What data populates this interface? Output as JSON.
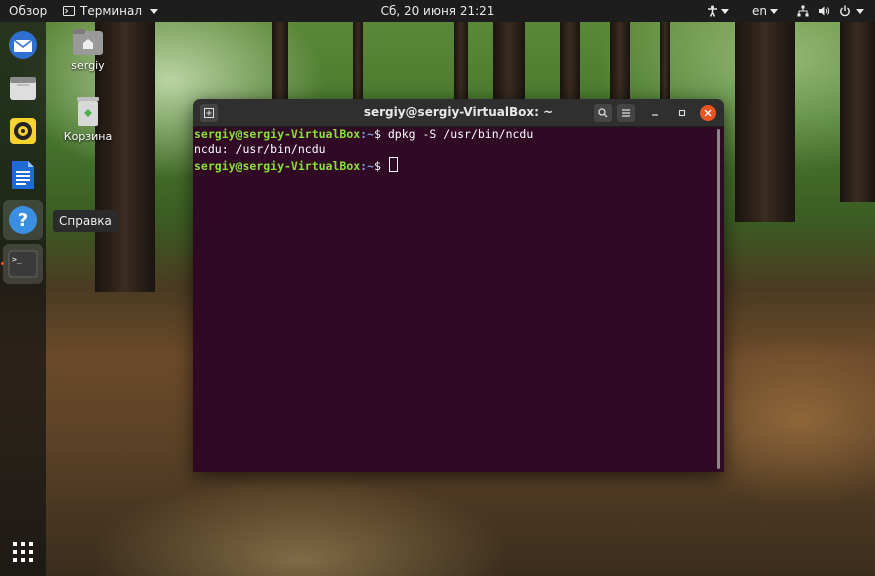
{
  "topbar": {
    "overview": "Обзор",
    "app_name": "Терминал",
    "clock": "Сб, 20 июня  21:21",
    "language": "en"
  },
  "dock": {
    "items": [
      {
        "icon": "thunderbird-icon"
      },
      {
        "icon": "files-icon"
      },
      {
        "icon": "rhythmbox-icon"
      },
      {
        "icon": "writer-icon"
      },
      {
        "icon": "help-icon"
      },
      {
        "icon": "terminal-icon"
      }
    ],
    "show_apps_icon": "apps-grid-icon"
  },
  "tooltip": "Справка",
  "desktop": {
    "home_label": "sergiy",
    "trash_label": "Корзина"
  },
  "terminal": {
    "title": "sergiy@sergiy-VirtualBox: ~",
    "lines": [
      {
        "prompt": "sergiy@sergiy-VirtualBox",
        "path": ":~",
        "cmd": "$ dpkg -S /usr/bin/ncdu"
      },
      {
        "output": "ncdu: /usr/bin/ncdu"
      },
      {
        "prompt": "sergiy@sergiy-VirtualBox",
        "path": ":~",
        "cmd": "$ "
      }
    ]
  },
  "colors": {
    "terminal_bg": "#300a24",
    "prompt_green": "#8ae234",
    "path_blue": "#729fcf",
    "close_orange": "#e95420"
  }
}
